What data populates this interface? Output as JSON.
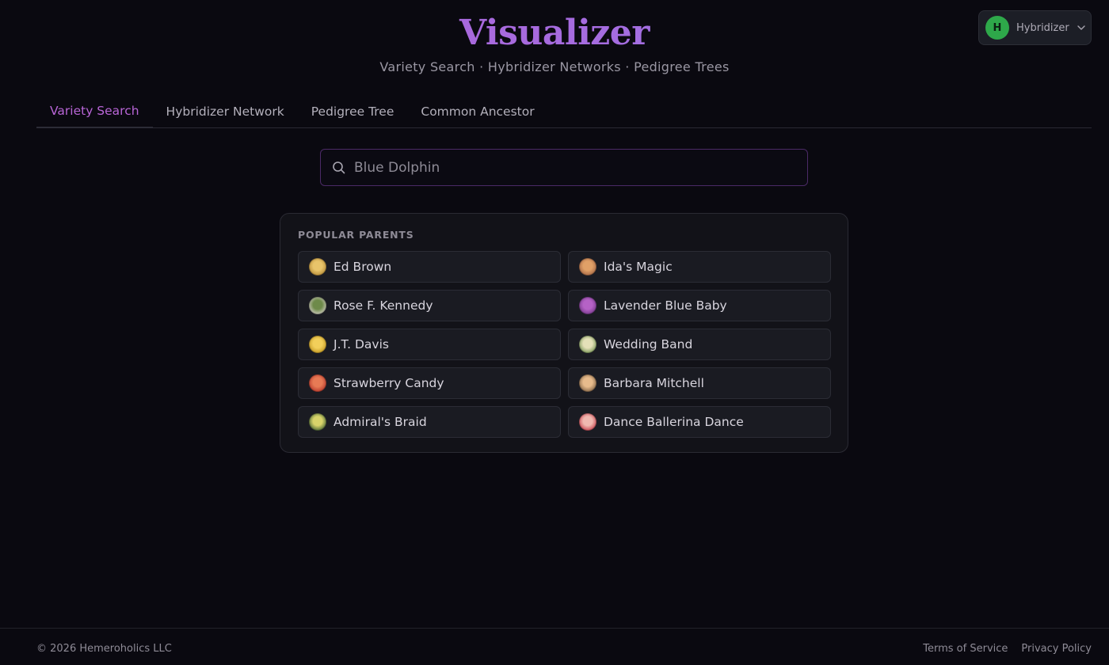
{
  "header": {
    "logo": "Visualizer",
    "subtitle": "Variety Search · Hybridizer Networks · Pedigree Trees"
  },
  "user": {
    "initial": "H",
    "name": "Hybridizer",
    "avatar_color": "#2ea84a"
  },
  "tabs": [
    {
      "label": "Variety Search",
      "active": true
    },
    {
      "label": "Hybridizer Network",
      "active": false
    },
    {
      "label": "Pedigree Tree",
      "active": false
    },
    {
      "label": "Common Ancestor",
      "active": false
    }
  ],
  "search": {
    "placeholder": "Blue Dolphin",
    "value": "",
    "icon": "search-icon"
  },
  "popular_parents": {
    "title": "POPULAR PARENTS",
    "items": [
      {
        "name": "Ed Brown",
        "thumb_colors": [
          "#e8c46a",
          "#b98f3a"
        ]
      },
      {
        "name": "Ida's Magic",
        "thumb_colors": [
          "#e0a067",
          "#a86a46"
        ]
      },
      {
        "name": "Rose F. Kennedy",
        "thumb_colors": [
          "#6e8a4a",
          "#c9c7b8"
        ]
      },
      {
        "name": "Lavender Blue Baby",
        "thumb_colors": [
          "#b562c6",
          "#7a3b8e"
        ]
      },
      {
        "name": "J.T. Davis",
        "thumb_colors": [
          "#f2cf5a",
          "#c49a24"
        ]
      },
      {
        "name": "Wedding Band",
        "thumb_colors": [
          "#e4e0b8",
          "#7f9a5c"
        ]
      },
      {
        "name": "Strawberry Candy",
        "thumb_colors": [
          "#e77a55",
          "#b83b2d"
        ]
      },
      {
        "name": "Barbara Mitchell",
        "thumb_colors": [
          "#e7bb8c",
          "#8a6a4a"
        ]
      },
      {
        "name": "Admiral's Braid",
        "thumb_colors": [
          "#d8d36a",
          "#4f6a36"
        ]
      },
      {
        "name": "Dance Ballerina Dance",
        "thumb_colors": [
          "#f0b8b0",
          "#c94a55"
        ]
      }
    ]
  },
  "footer": {
    "copyright": "© 2026 Hemeroholics LLC",
    "links": [
      "Terms of Service",
      "Privacy Policy"
    ]
  },
  "colors": {
    "background": "#0a0910",
    "accent": "#b865d6",
    "panel": "#121218"
  }
}
